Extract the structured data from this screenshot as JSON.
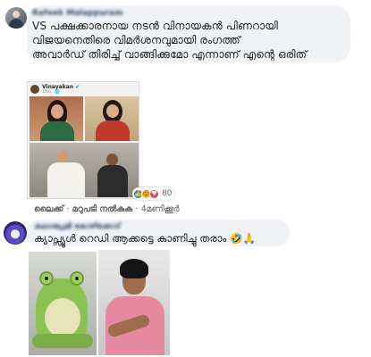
{
  "comment1": {
    "author": "Rafeek Malappuram",
    "text_lines": [
      "VS പക്ഷക്കാരനായ നടൻ വിനായകൻ പിണറായി",
      "വിജയനെതിരെ വിമർശനവുമായി രംഗത്ത്",
      "അവാർഡ് തിരിച്ച് വാങ്ങിക്കുമോ എന്നാണ് എന്റെ ഒരിത്"
    ],
    "embedded_post": {
      "name": "Vinayakan",
      "verified_badge": "✔",
      "subtitle": "19m · 🌐"
    },
    "reactions": {
      "icons": [
        "like-icon",
        "haha-icon",
        "love-icon"
      ],
      "count": "80"
    },
    "actions": {
      "like": "ലൈക്ക്",
      "reply": "മറുപടി നൽകുക",
      "time": "4മണിക്കൂർ",
      "separator": "·"
    }
  },
  "comment2": {
    "author": "കലാപ്രേമി കോഴിക്കോട്",
    "text": "ക്യാപ്സ്യൂൾ റെഡി ആക്കട്ടെ കാണിച്ചു തരാം 🤣🙏"
  },
  "colors": {
    "bubble": "#f0f2f5",
    "text": "#1c1e21",
    "meta": "#65676b",
    "like_blue": "#1877f2"
  }
}
